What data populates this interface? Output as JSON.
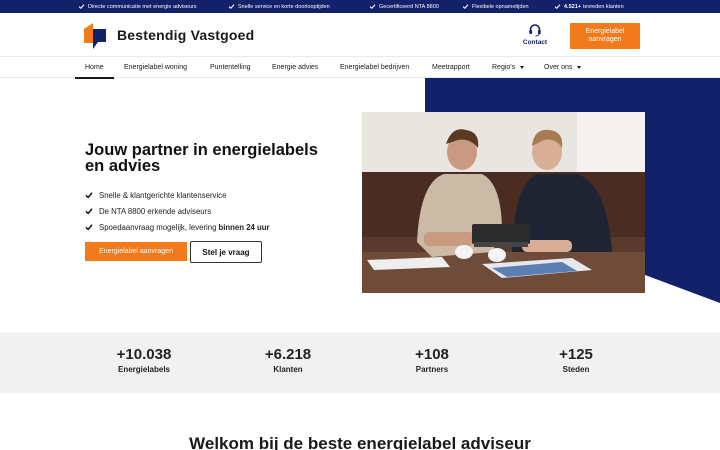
{
  "topbar": {
    "items": [
      {
        "bold": "",
        "text": "Directe communicatie met energie adviseurs"
      },
      {
        "bold": "",
        "text": "Snelle service en korte doorlooptijden"
      },
      {
        "bold": "",
        "text": "Gecertificeerd NTA 8800"
      },
      {
        "bold": "",
        "text": "Flexibele opnametijden"
      },
      {
        "bold": "4.521+",
        "text": "tevreden klanten"
      }
    ]
  },
  "header": {
    "brand": "Bestendig Vastgoed",
    "contact_label": "Contact",
    "cta_line1": "Energielabel",
    "cta_line2": "aanvragen"
  },
  "nav": {
    "items": [
      {
        "label": "Home"
      },
      {
        "label": "Energielabel woning"
      },
      {
        "label": "Puntentelling"
      },
      {
        "label": "Energie advies"
      },
      {
        "label": "Energielabel bedrijven"
      },
      {
        "label": "Meetrapport"
      },
      {
        "label": "Regio's"
      },
      {
        "label": "Over ons"
      }
    ]
  },
  "hero": {
    "title": "Jouw partner in energielabels en advies",
    "bullets": [
      {
        "text": "Snelle & klantgerichte klantenservice",
        "bold": ""
      },
      {
        "text": "De NTA 8800 erkende adviseurs",
        "bold": ""
      },
      {
        "text": "Spoedaanvraag mogelijk, levering",
        "bold": "binnen 24 uur"
      }
    ],
    "primary_button": "Energielabel aanvragen",
    "secondary_button": "Stel je vraag"
  },
  "stats": [
    {
      "value": "+10.038",
      "label": "Energielabels"
    },
    {
      "value": "+6.218",
      "label": "Klanten"
    },
    {
      "value": "+108",
      "label": "Partners"
    },
    {
      "value": "+125",
      "label": "Steden"
    }
  ],
  "welcome": {
    "heading": "Welkom bij de beste energielabel adviseur"
  },
  "colors": {
    "navy": "#12216a",
    "orange": "#f27a1a",
    "stats_bg": "#f1f1f1"
  }
}
